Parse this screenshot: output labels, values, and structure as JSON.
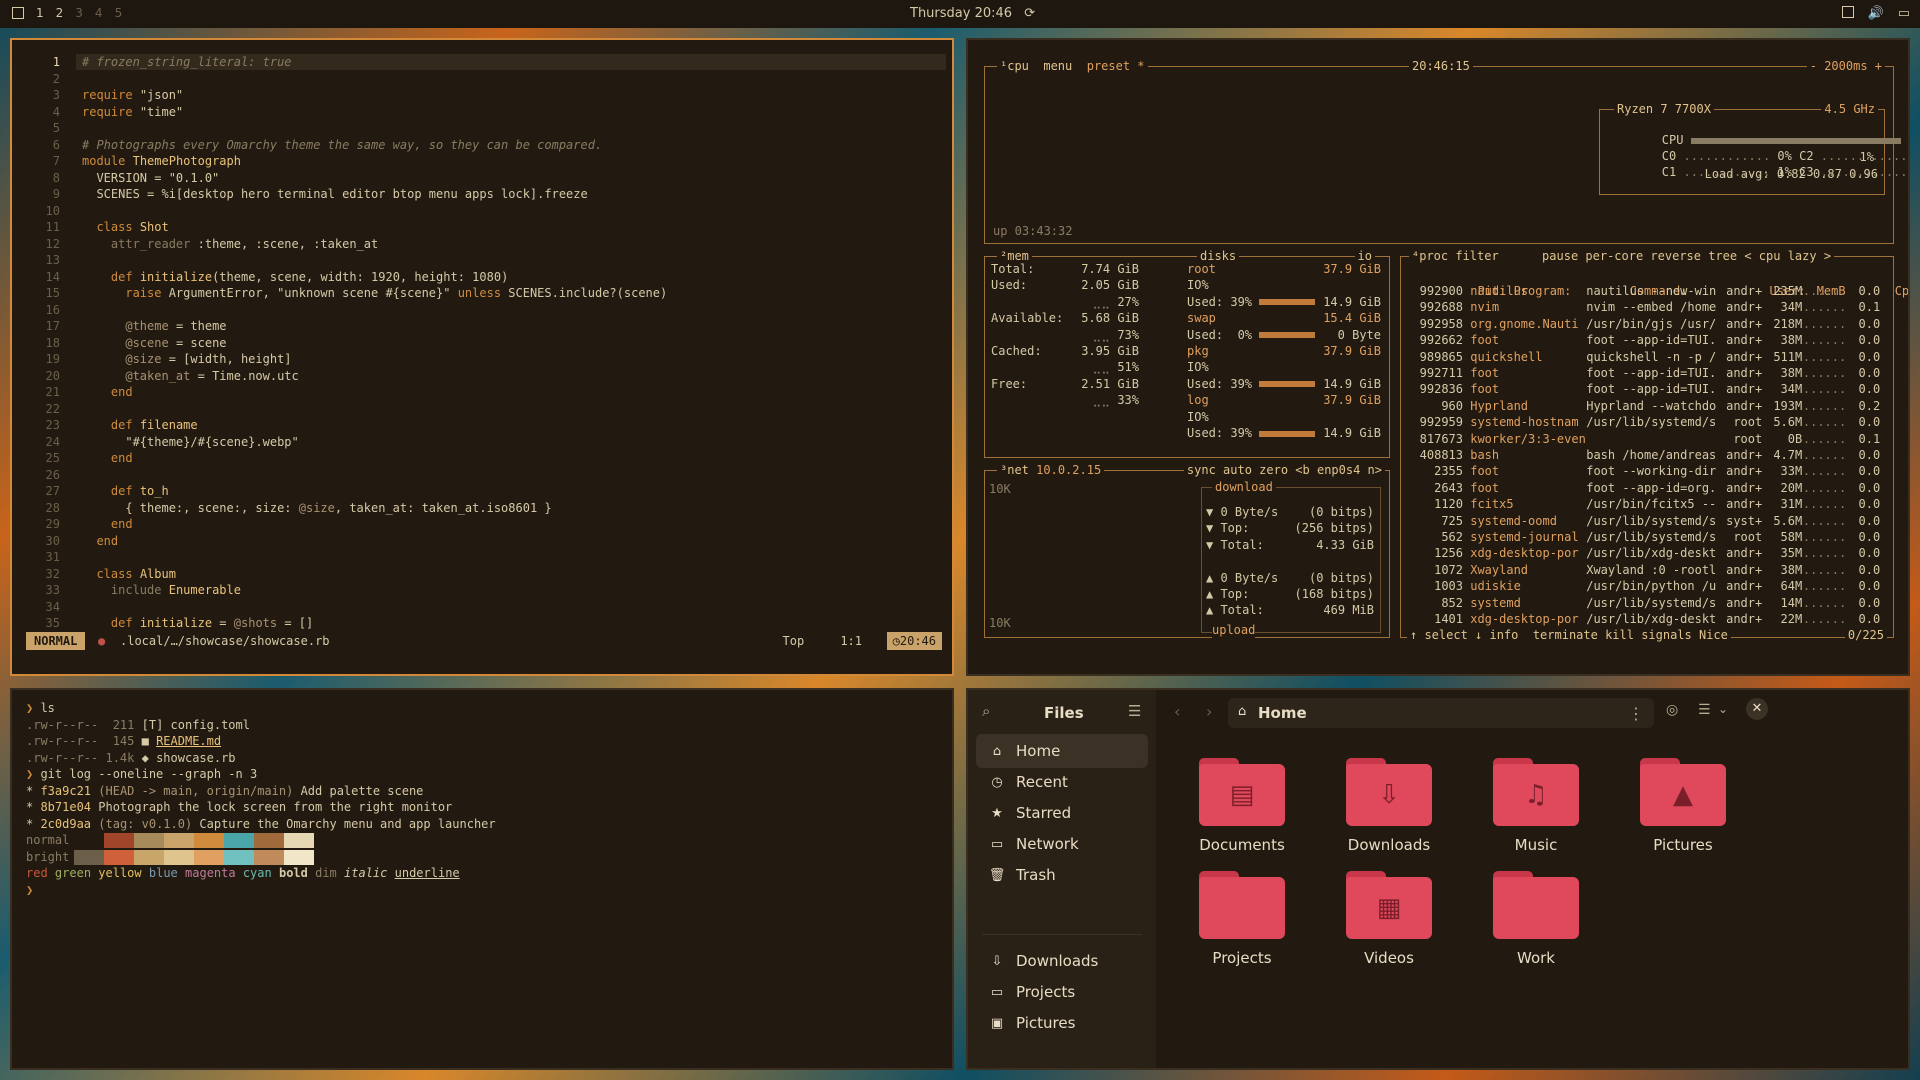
{
  "topbar": {
    "workspaces": [
      "1",
      "2",
      "3",
      "4",
      "5"
    ],
    "datetime": "Thursday 20:46"
  },
  "editor": {
    "lines": [
      {
        "n": "1",
        "html": "<span class=\"cm\"># frozen_string_literal: true</span>"
      },
      {
        "n": "2",
        "html": ""
      },
      {
        "n": "3",
        "html": "<span class=\"kw\">require</span> <span class=\"str\">\"json\"</span>"
      },
      {
        "n": "4",
        "html": "<span class=\"kw\">require</span> <span class=\"str\">\"time\"</span>"
      },
      {
        "n": "5",
        "html": ""
      },
      {
        "n": "6",
        "html": "<span class=\"cm\"># Photographs every Omarchy theme the same way, so they can be compared.</span>"
      },
      {
        "n": "7",
        "html": "<span class=\"kw\">module</span> <span class=\"cls\">ThemePhotograph</span>"
      },
      {
        "n": "8",
        "html": "  VERSION = <span class=\"str\">\"0.1.0\"</span>"
      },
      {
        "n": "9",
        "html": "  SCENES = %i[desktop hero terminal editor btop menu apps lock].freeze"
      },
      {
        "n": "10",
        "html": ""
      },
      {
        "n": "11",
        "html": "  <span class=\"kw\">class</span> <span class=\"cls\">Shot</span>"
      },
      {
        "n": "12",
        "html": "    <span class=\"dim2\">attr_reader</span> :theme, :scene, :taken_at"
      },
      {
        "n": "13",
        "html": ""
      },
      {
        "n": "14",
        "html": "    <span class=\"kw\">def</span> <span class=\"cls\">initialize</span>(theme, scene, width: 1920, height: 1080)"
      },
      {
        "n": "15",
        "html": "      <span class=\"kw\">raise</span> ArgumentError, <span class=\"str\">\"unknown scene #{scene}\"</span> <span class=\"kw\">unless</span> SCENES.include?(scene)"
      },
      {
        "n": "16",
        "html": ""
      },
      {
        "n": "17",
        "html": "      <span class=\"iv\">@theme</span> = theme"
      },
      {
        "n": "18",
        "html": "      <span class=\"iv\">@scene</span> = scene"
      },
      {
        "n": "19",
        "html": "      <span class=\"iv\">@size</span> = [width, height]"
      },
      {
        "n": "20",
        "html": "      <span class=\"iv\">@taken_at</span> = Time.now.utc"
      },
      {
        "n": "21",
        "html": "    <span class=\"kw\">end</span>"
      },
      {
        "n": "22",
        "html": ""
      },
      {
        "n": "23",
        "html": "    <span class=\"kw\">def</span> <span class=\"cls\">filename</span>"
      },
      {
        "n": "24",
        "html": "      <span class=\"str\">\"#{theme}/#{scene}.webp\"</span>"
      },
      {
        "n": "25",
        "html": "    <span class=\"kw\">end</span>"
      },
      {
        "n": "26",
        "html": ""
      },
      {
        "n": "27",
        "html": "    <span class=\"kw\">def</span> <span class=\"cls\">to_h</span>"
      },
      {
        "n": "28",
        "html": "      { theme:, scene:, size: <span class=\"iv\">@size</span>, taken_at: taken_at.iso8601 }"
      },
      {
        "n": "29",
        "html": "    <span class=\"kw\">end</span>"
      },
      {
        "n": "30",
        "html": "  <span class=\"kw\">end</span>"
      },
      {
        "n": "31",
        "html": ""
      },
      {
        "n": "32",
        "html": "  <span class=\"kw\">class</span> <span class=\"cls\">Album</span>"
      },
      {
        "n": "33",
        "html": "    <span class=\"dim2\">include</span> <span class=\"cls\">Enumerable</span>"
      },
      {
        "n": "34",
        "html": ""
      },
      {
        "n": "35",
        "html": "    <span class=\"kw\">def</span> <span class=\"cls\">initialize</span> = <span class=\"iv\">@shots</span> = []"
      }
    ],
    "mode": "NORMAL",
    "path": ".local/…/showcase/showcase.rb",
    "position_label": "Top",
    "cursor": "1:1",
    "time": "20:46"
  },
  "btop": {
    "cpu_title": "¹cpu",
    "menu": "menu",
    "preset": "preset *",
    "clock": "20:46:15",
    "interval": "- 2000ms +",
    "uptime": "up 03:43:32",
    "cpu_model": "Ryzen 7 7700X",
    "cpu_freq": "4.5 GHz",
    "cpu_rows": [
      {
        "label": "CPU",
        "val": "1%",
        "fill": 0.02
      },
      {
        "label": "C0",
        "val": "0%",
        "label2": "C2",
        "val2": "0%"
      },
      {
        "label": "C1",
        "val": "1%",
        "label2": "C3",
        "val2": "1%"
      }
    ],
    "load_avg": "Load avg: 0.82 0.87 0.96",
    "mem_title": "²mem",
    "disks_title": "disks",
    "io": "io",
    "mem": [
      {
        "k": "Total:",
        "v": "7.74 GiB"
      },
      {
        "k": "Used:",
        "v": "2.05 GiB",
        "p": "27%"
      },
      {
        "k": "Available:",
        "v": "5.68 GiB",
        "p": "73%"
      },
      {
        "k": "Cached:",
        "v": "3.95 GiB",
        "p": "51%"
      },
      {
        "k": "Free:",
        "v": "2.51 GiB",
        "p": "33%"
      }
    ],
    "disks": [
      {
        "name": "root",
        "size": "37.9 GiB",
        "io": "IO%",
        "used": "Used: 39%",
        "used_v": "14.9 GiB"
      },
      {
        "name": "swap",
        "size": "15.4 GiB",
        "io": "",
        "used": "Used:  0%",
        "used_v": "0 Byte"
      },
      {
        "name": "pkg",
        "size": "37.9 GiB",
        "io": "IO%",
        "used": "Used: 39%",
        "used_v": "14.9 GiB"
      },
      {
        "name": "log",
        "size": "37.9 GiB",
        "io": "IO%",
        "used": "Used: 39%",
        "used_v": "14.9 GiB"
      }
    ],
    "net_title": "³net",
    "net_ip": "10.0.2.15",
    "net_opts": "sync auto zero <b enp0s4 n>",
    "net_scale_top": "10K",
    "net_scale_bot": "10K",
    "net_download": "download",
    "net_upload": "upload",
    "net_rows": [
      {
        "k": "▼ 0 Byte/s",
        "v": "(0 bitps)"
      },
      {
        "k": "▼ Top:",
        "v": "(256 bitps)"
      },
      {
        "k": "▼ Total:",
        "v": "4.33 GiB"
      },
      {
        "k": "",
        "v": ""
      },
      {
        "k": "▲ 0 Byte/s",
        "v": "(0 bitps)"
      },
      {
        "k": "▲ Top:",
        "v": "(168 bitps)"
      },
      {
        "k": "▲ Total:",
        "v": "469 MiB"
      }
    ],
    "proc_title": "⁴proc",
    "proc_opts": "filter      pause per-core reverse tree < cpu lazy >",
    "proc_header": {
      "pid": "Pid:",
      "prog": "Program:",
      "cmd": "Command:",
      "user": "User:",
      "mem": "MemB",
      "cpu": "Cpu%"
    },
    "procs": [
      {
        "pid": "992900",
        "prog": "nautilus",
        "cmd": "nautilus --new-win",
        "user": "andr+",
        "mem": "235M",
        "cpu": "0.0"
      },
      {
        "pid": "992688",
        "prog": "nvim",
        "cmd": "nvim --embed /home",
        "user": "andr+",
        "mem": "34M",
        "cpu": "0.1"
      },
      {
        "pid": "992958",
        "prog": "org.gnome.Nauti",
        "cmd": "/usr/bin/gjs /usr/",
        "user": "andr+",
        "mem": "218M",
        "cpu": "0.0"
      },
      {
        "pid": "992662",
        "prog": "foot",
        "cmd": "foot --app-id=TUI.",
        "user": "andr+",
        "mem": "38M",
        "cpu": "0.0"
      },
      {
        "pid": "989865",
        "prog": "quickshell",
        "cmd": "quickshell -n -p /",
        "user": "andr+",
        "mem": "511M",
        "cpu": "0.0"
      },
      {
        "pid": "992711",
        "prog": "foot",
        "cmd": "foot --app-id=TUI.",
        "user": "andr+",
        "mem": "38M",
        "cpu": "0.0"
      },
      {
        "pid": "992836",
        "prog": "foot",
        "cmd": "foot --app-id=TUI.",
        "user": "andr+",
        "mem": "34M",
        "cpu": "0.0"
      },
      {
        "pid": "960",
        "prog": "Hyprland",
        "cmd": "Hyprland --watchdo",
        "user": "andr+",
        "mem": "193M",
        "cpu": "0.2"
      },
      {
        "pid": "992959",
        "prog": "systemd-hostnam",
        "cmd": "/usr/lib/systemd/s",
        "user": "root",
        "mem": "5.6M",
        "cpu": "0.0"
      },
      {
        "pid": "817673",
        "prog": "kworker/3:3-even",
        "cmd": "",
        "user": "root",
        "mem": "0B",
        "cpu": "0.1"
      },
      {
        "pid": "408813",
        "prog": "bash",
        "cmd": "bash /home/andreas",
        "user": "andr+",
        "mem": "4.7M",
        "cpu": "0.0"
      },
      {
        "pid": "2355",
        "prog": "foot",
        "cmd": "foot --working-dir",
        "user": "andr+",
        "mem": "33M",
        "cpu": "0.0"
      },
      {
        "pid": "2643",
        "prog": "foot",
        "cmd": "foot --app-id=org.",
        "user": "andr+",
        "mem": "20M",
        "cpu": "0.0"
      },
      {
        "pid": "1120",
        "prog": "fcitx5",
        "cmd": "/usr/bin/fcitx5 --",
        "user": "andr+",
        "mem": "31M",
        "cpu": "0.0"
      },
      {
        "pid": "725",
        "prog": "systemd-oomd",
        "cmd": "/usr/lib/systemd/s",
        "user": "syst+",
        "mem": "5.6M",
        "cpu": "0.0"
      },
      {
        "pid": "562",
        "prog": "systemd-journal",
        "cmd": "/usr/lib/systemd/s",
        "user": "root",
        "mem": "58M",
        "cpu": "0.0"
      },
      {
        "pid": "1256",
        "prog": "xdg-desktop-por",
        "cmd": "/usr/lib/xdg-deskt",
        "user": "andr+",
        "mem": "35M",
        "cpu": "0.0"
      },
      {
        "pid": "1072",
        "prog": "Xwayland",
        "cmd": "Xwayland :0 -rootl",
        "user": "andr+",
        "mem": "38M",
        "cpu": "0.0"
      },
      {
        "pid": "1003",
        "prog": "udiskie",
        "cmd": "/usr/bin/python /u",
        "user": "andr+",
        "mem": "64M",
        "cpu": "0.0"
      },
      {
        "pid": "852",
        "prog": "systemd",
        "cmd": "/usr/lib/systemd/s",
        "user": "andr+",
        "mem": "14M",
        "cpu": "0.0"
      },
      {
        "pid": "1401",
        "prog": "xdg-desktop-por",
        "cmd": "/usr/lib/xdg-deskt",
        "user": "andr+",
        "mem": "22M",
        "cpu": "0.0"
      }
    ],
    "proc_footer": "↑ select ↓ info  terminate kill signals Nice",
    "proc_count": "0/225"
  },
  "terminal": {
    "lines": [
      {
        "html": "<span class=\"kw\">❯</span> ls"
      },
      {
        "html": "<span class=\"muted\">.rw-r--r--</span>  <span class=\"muted\">211</span> [T] config.toml"
      },
      {
        "html": "<span class=\"muted\">.rw-r--r--</span>  <span class=\"muted\">145</span> ■ <u class=\"cls\">README.md</u>"
      },
      {
        "html": "<span class=\"muted\">.rw-r--r--</span> <span class=\"muted\">1.4k</span> ◆ showcase.rb"
      },
      {
        "html": "<span class=\"kw\">❯</span> git log --oneline --graph -n 3"
      },
      {
        "html": "* <span class=\"cls\">f3a9c21</span> <span class=\"iv\">(HEAD -> main, origin/main)</span> Add palette scene"
      },
      {
        "html": "* <span class=\"cls\">8b71e04</span> Photograph the lock screen from the right monitor"
      },
      {
        "html": "* <span class=\"cls\">2c0d9aa</span> <span class=\"iv\">(tag: v0.1.0)</span> Capture the Omarchy menu and app launcher"
      }
    ],
    "palette_normal_label": "normal",
    "palette_bright_label": "bright",
    "palette_normal": [
      "#221a10",
      "#a0452a",
      "#a68a5a",
      "#c9a36a",
      "#cf8a3c",
      "#4aa6a8",
      "#a06a3a",
      "#e6d7b5"
    ],
    "palette_bright": [
      "#6c5f4a",
      "#d0603a",
      "#c8a66a",
      "#e0c48e",
      "#e0a060",
      "#70c0c0",
      "#c08a5a",
      "#f2e6c8"
    ],
    "sample_line_html": "<span style=\"color:#c8583a\">red</span> <span style=\"color:#a0b060\">green</span> <span style=\"color:#e0c060\">yellow</span> <span style=\"color:#7a9ab0\">blue</span> <span style=\"color:#c07a9a\">magenta</span> <span style=\"color:#6abab0\">cyan</span> <b>bold</b> <span class=\"muted\">dim</span> <i>italic</i> <u>underline</u>",
    "prompt": "❯"
  },
  "files": {
    "title": "Files",
    "location": "Home",
    "sidebar": [
      {
        "label": "Home",
        "icon": "⌂",
        "sel": true
      },
      {
        "label": "Recent",
        "icon": "◷",
        "sel": false
      },
      {
        "label": "Starred",
        "icon": "★",
        "sel": false
      },
      {
        "label": "Network",
        "icon": "▭",
        "sel": false
      },
      {
        "label": "Trash",
        "icon": "🗑",
        "sel": false
      }
    ],
    "bookmarks": [
      {
        "label": "Downloads",
        "icon": "⇩"
      },
      {
        "label": "Projects",
        "icon": "▭"
      },
      {
        "label": "Pictures",
        "icon": "▣"
      }
    ],
    "folders": [
      {
        "label": "Documents",
        "glyph": "▤"
      },
      {
        "label": "Downloads",
        "glyph": "⇩"
      },
      {
        "label": "Music",
        "glyph": "♫"
      },
      {
        "label": "Pictures",
        "glyph": "▲"
      },
      {
        "label": "Projects",
        "glyph": ""
      },
      {
        "label": "Videos",
        "glyph": "▦"
      },
      {
        "label": "Work",
        "glyph": ""
      }
    ]
  }
}
